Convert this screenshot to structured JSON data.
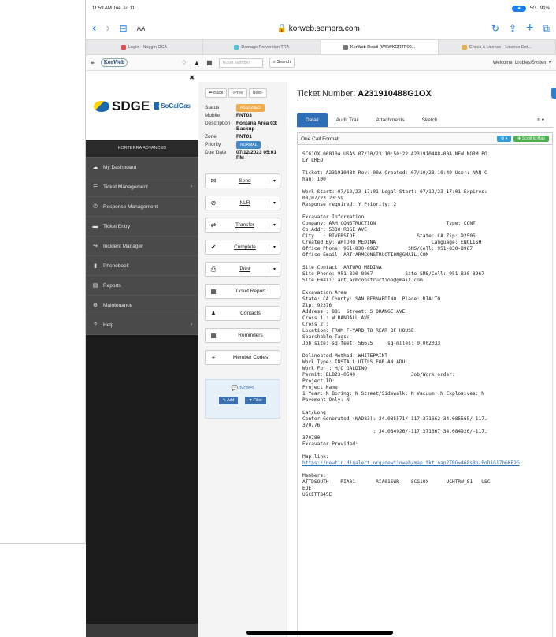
{
  "status_bar": {
    "time": "11:59 AM  Tue Jul 11",
    "signal": "5G",
    "battery": "91%"
  },
  "browser": {
    "url": "korweb.sempra.com",
    "text_size": "AA",
    "tabs": [
      {
        "label": "Login - Noggin OCA",
        "color": "#d9534f",
        "active": false
      },
      {
        "label": "Damage Prevention TRA",
        "color": "#5bc0de",
        "active": false
      },
      {
        "label": "KorWeb Detail (WSWKORTP00...",
        "color": "#777777",
        "active": true
      },
      {
        "label": "Check A License - License Det...",
        "color": "#f0ad4e",
        "active": false
      }
    ]
  },
  "app_header": {
    "logo": "KorWeb",
    "ticket_number_placeholder": "Ticket Number",
    "search_label": "Search",
    "welcome": "Welcome, Lrobles/System"
  },
  "sidebar": {
    "brand_sdge": "SDGE",
    "brand_scg": "SoCalGas",
    "section": "KORTERRA ADVANCED",
    "items": [
      {
        "label": "My Dashboard",
        "icon": "cloud-icon"
      },
      {
        "label": "Ticket Management",
        "icon": "list-icon",
        "arrow": true
      },
      {
        "label": "Response Management",
        "icon": "megaphone-icon"
      },
      {
        "label": "Ticket Entry",
        "icon": "ticket-icon"
      },
      {
        "label": "Incident Manager",
        "icon": "share-icon"
      },
      {
        "label": "Phonebook",
        "icon": "book-icon"
      },
      {
        "label": "Reports",
        "icon": "report-icon"
      },
      {
        "label": "Maintenance",
        "icon": "gears-icon"
      },
      {
        "label": "Help",
        "icon": "question-icon",
        "arrow": true
      }
    ]
  },
  "details": {
    "back": "Back",
    "prev": "Prev",
    "next": "Next",
    "fields": [
      {
        "key": "Status",
        "value": "ASSIGNED",
        "badge": "#f0ad4e"
      },
      {
        "key": "Mobile",
        "value": "FNT03"
      },
      {
        "key": "Description",
        "value": "Fontana Area 03: Backup"
      },
      {
        "key": "Zone",
        "value": "FNT01"
      },
      {
        "key": "Priority",
        "value": "NORMAL",
        "badge": "#428bca"
      },
      {
        "key": "Due Date",
        "value": "07/12/2023 05:01 PM"
      }
    ],
    "actions": [
      {
        "label": "Send",
        "icon": "envelope-icon",
        "glyph": "✉"
      },
      {
        "label": "NLR",
        "icon": "ban-icon",
        "glyph": "⊘"
      },
      {
        "label": "Transfer",
        "icon": "transfer-icon",
        "glyph": "⇄"
      },
      {
        "label": "Complete",
        "icon": "check-icon",
        "glyph": "✔"
      },
      {
        "label": "Print",
        "icon": "print-icon",
        "glyph": "⎙"
      }
    ],
    "buttons": [
      {
        "label": "Ticket Report",
        "icon": "report-icon",
        "glyph": "▦"
      },
      {
        "label": "Contacts",
        "icon": "user-icon",
        "glyph": "♟"
      },
      {
        "label": "Reminders",
        "icon": "calendar-icon",
        "glyph": "▦"
      },
      {
        "label": "Member Codes",
        "icon": "plus-icon",
        "glyph": "+"
      }
    ],
    "notes": {
      "title": "Notes",
      "add": "Add",
      "filter": "Filter"
    }
  },
  "ticket": {
    "title_prefix": "Ticket Number:",
    "number": "A231910488G1OX",
    "tabs": [
      "Detail",
      "Audit Trail",
      "Attachments",
      "Sketch"
    ],
    "one_call_label": "One Call Format",
    "scroll_to_map": "Scroll to Map",
    "text_main": "SCG1OX 00010A USAS 07/10/23 10:50:22 A231910488-00A NEW NORM PO\nLY LREQ\n\nTicket: A231910488 Rev: 00A Created: 07/10/23 10:49 User: NAN C\nhan: 100\n\nWork Start: 07/12/23 17:01 Legal Start: 07/12/23 17:01 Expires:\n08/07/23 23:59\nResponse required: Y Priority: 2\n\nExcavator Information\nCompany: ARM CONSTRUCTION                        Type: CONT\nCo Addr: 5330 ROSE AVE\nCity   : RIVERSIDE                     State: CA Zip: 92505\nCreated By: ARTURO MEDINA                   Language: ENGLISH\nOffice Phone: 951-830-8967          SMS/Cell: 951-830-8967\nOffice Email: ART.ARMCONSTRUCTION@GMAIL.COM\n\nSite Contact: ARTURO MEDINA\nSite Phone: 951-830-8967           Site SMS/Cell: 951-830-8967\nSite Email: art.armconstruction@gmail.com\n\nExcavation Area\nState: CA County: SAN BERNARDINO  Place: RIALTO\nZip: 92376\nAddress : 881  Street: S ORANGE AVE\nCross 1 : W RANDALL AVE\nCross 2 :\nLocation: FROM F-YARD TO REAR OF HOUSE\nSearchable Tags:\nJob size: sq-feet: 56675     sq-miles: 0.002033\n\nDelineated Method: WHITEPAINT\nWork Type: INSTALL UITLS FOR AN ADU\nWork For : H/O GALDINO\nPermit: BLB23-0540                   Job/Work order:\nProject ID:\nProject Name:\n1 Year: N Boring: N Street/Sidewalk: N Vacuum: N Explosives: N\nPavement Only: N\n\nLat/Long\nCenter Generated (NAD83): 34.085571/-117.371662 34.085565/-117.\n370776\n                        : 34.084926/-117.371667 34.084920/-117.\n370780\nExcavator Provided:\n\nMap link:",
    "map_link": "https://newtin.digalert.org/newtinweb/map_tkt.nap?TRG=468s8p-PoD1G17hGKE2G",
    "text_members": "Members:\nATTDSOUTH    RIA01       RIA01SWR    SCG1OX      UCHTRW_S1   USC\nEDE\nUSCETT845E"
  }
}
